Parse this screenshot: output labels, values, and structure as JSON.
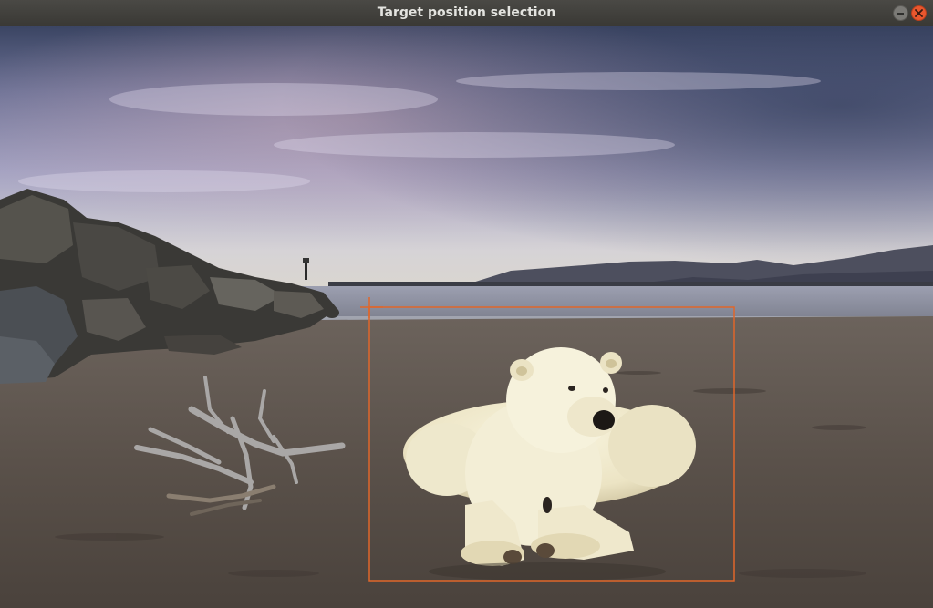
{
  "window": {
    "title": "Target position selection",
    "buttons": {
      "minimize": "minimize-icon",
      "close": "close-icon"
    }
  },
  "scene": {
    "description_icons": [
      "polar-bear",
      "driftwood",
      "rocks",
      "sea",
      "sky",
      "hills",
      "lighthouse"
    ]
  },
  "selection": {
    "color": "#e0662a"
  },
  "colors": {
    "sky_top": "#3f4a68",
    "sky_mid": "#8d8fb3",
    "horizon": "#d9d7d6",
    "sea": "#8a8d9a",
    "sand": "#5f564f",
    "bear": "#efe9cc"
  }
}
